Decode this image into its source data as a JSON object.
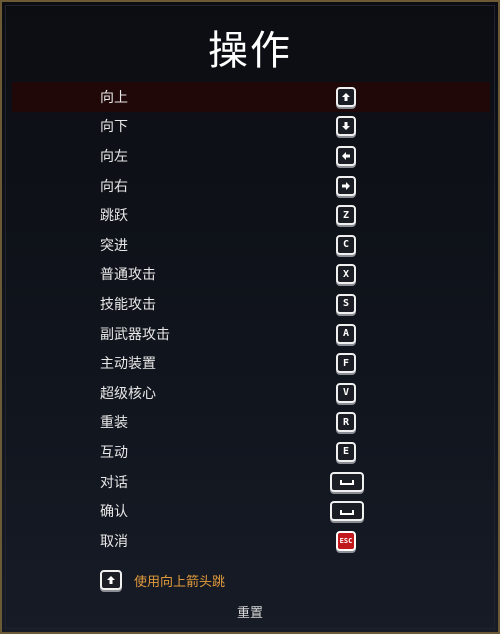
{
  "title": "操作",
  "controls": [
    {
      "label": "向上",
      "key": "up-arrow",
      "selected": true
    },
    {
      "label": "向下",
      "key": "down-arrow"
    },
    {
      "label": "向左",
      "key": "left-arrow"
    },
    {
      "label": "向右",
      "key": "right-arrow"
    },
    {
      "label": "跳跃",
      "key": "Z"
    },
    {
      "label": "突进",
      "key": "C"
    },
    {
      "label": "普通攻击",
      "key": "X"
    },
    {
      "label": "技能攻击",
      "key": "S"
    },
    {
      "label": "副武器攻击",
      "key": "A"
    },
    {
      "label": "主动装置",
      "key": "F"
    },
    {
      "label": "超级核心",
      "key": "V"
    },
    {
      "label": "重装",
      "key": "R"
    },
    {
      "label": "互动",
      "key": "E"
    },
    {
      "label": "对话",
      "key": "space-bar"
    },
    {
      "label": "确认",
      "key": "space-bar"
    },
    {
      "label": "取消",
      "key": "ESC"
    }
  ],
  "hint": {
    "key": "up-arrow",
    "label": "使用向上箭头跳"
  },
  "reset_label": "重置",
  "colors": {
    "border": "#6b5a35",
    "selected_row": "#200808",
    "hint_text": "#e29a3c",
    "esc_key": "#c0181c"
  }
}
